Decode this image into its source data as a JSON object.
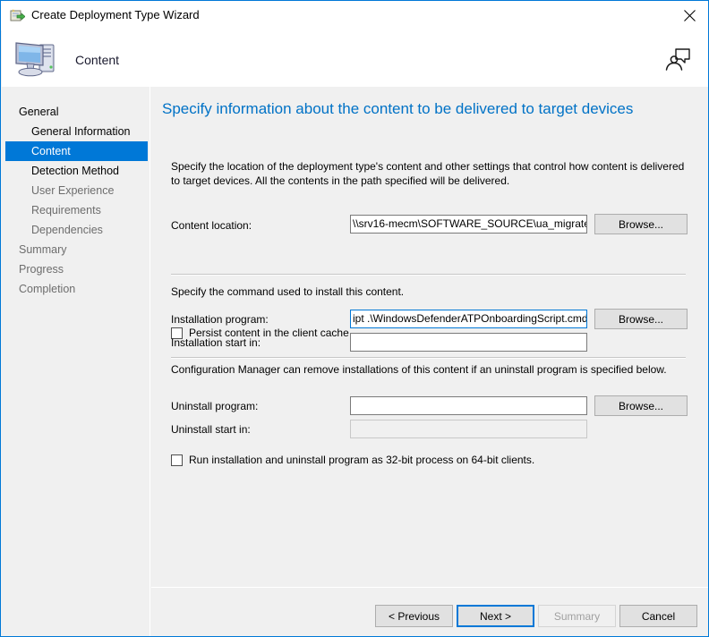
{
  "window": {
    "title": "Create Deployment Type Wizard",
    "title_icon": "create-wizard-icon",
    "close_label": "Close"
  },
  "header": {
    "title": "Content",
    "icon": "computer-icon",
    "help_icon": "help-person-icon"
  },
  "sidebar": {
    "items": [
      {
        "label": "General",
        "level": 0,
        "state": "enabled"
      },
      {
        "label": "General Information",
        "level": 1,
        "state": "enabled"
      },
      {
        "label": "Content",
        "level": 1,
        "state": "selected"
      },
      {
        "label": "Detection Method",
        "level": 1,
        "state": "enabled"
      },
      {
        "label": "User Experience",
        "level": 1,
        "state": "disabled"
      },
      {
        "label": "Requirements",
        "level": 1,
        "state": "disabled"
      },
      {
        "label": "Dependencies",
        "level": 1,
        "state": "disabled"
      },
      {
        "label": "Summary",
        "level": 0,
        "state": "disabled"
      },
      {
        "label": "Progress",
        "level": 0,
        "state": "disabled"
      },
      {
        "label": "Completion",
        "level": 0,
        "state": "disabled"
      }
    ]
  },
  "main": {
    "heading": "Specify information about the content to be delivered to target devices",
    "intro": "Specify the location of the deployment type's content and other settings that control how content is delivered to target devices. All the contents in the path specified will be delivered.",
    "content_location": {
      "label": "Content location:",
      "value": "\\\\srv16-mecm\\SOFTWARE_SOURCE\\ua_migrate",
      "browse_label": "Browse..."
    },
    "persist_checkbox": {
      "label": "Persist content in the client cache",
      "checked": false
    },
    "install_section_text": "Specify the command used to install this content.",
    "installation_program": {
      "label": "Installation program:",
      "value": "ipt .\\WindowsDefenderATPOnboardingScript.cmd",
      "browse_label": "Browse...",
      "focused": true
    },
    "installation_start_in": {
      "label": "Installation start in:",
      "value": ""
    },
    "uninstall_section_text": "Configuration Manager can remove installations of this content if an uninstall program is specified below.",
    "uninstall_program": {
      "label": "Uninstall program:",
      "value": "",
      "browse_label": "Browse..."
    },
    "uninstall_start_in": {
      "label": "Uninstall start in:",
      "value": "",
      "disabled": true
    },
    "run32bit_checkbox": {
      "label": "Run installation and uninstall program as 32-bit process on 64-bit clients.",
      "checked": false
    }
  },
  "footer": {
    "previous_label": "< Previous",
    "next_label": "Next >",
    "summary_label": "Summary",
    "cancel_label": "Cancel"
  },
  "colors": {
    "accent": "#0078d7",
    "heading": "#0072c6",
    "panel": "#f0f0f0",
    "disabled_text": "#6d6d6d"
  }
}
